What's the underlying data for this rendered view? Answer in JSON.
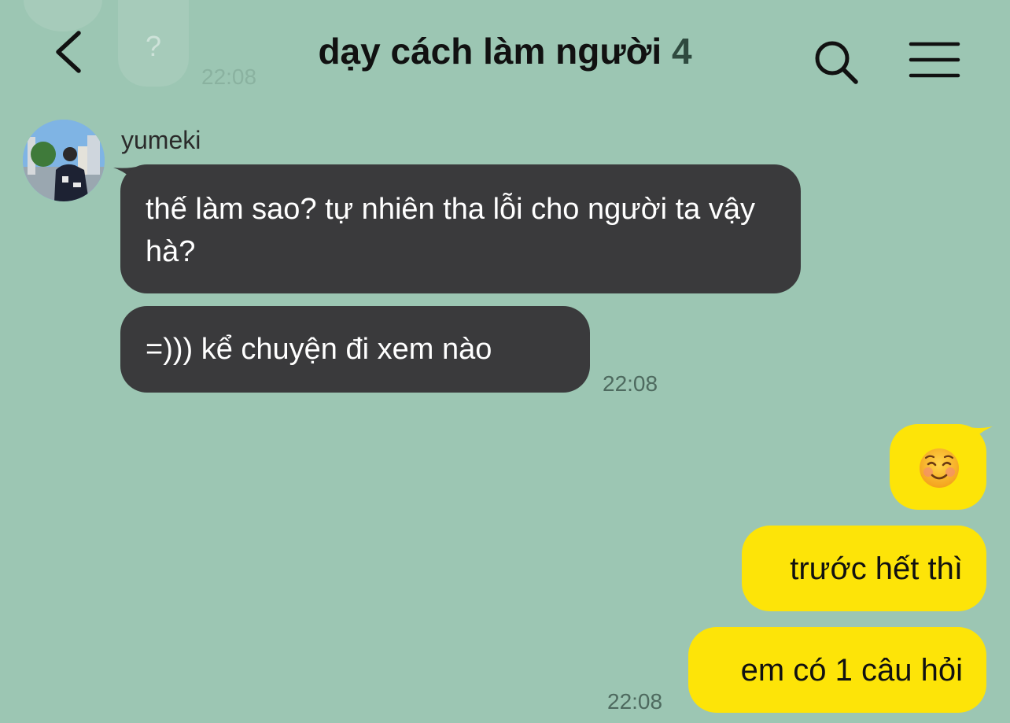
{
  "header": {
    "title": "dạy cách làm người",
    "member_count": "4",
    "faded_prev_text": "?",
    "faded_prev_time": "22:08"
  },
  "messages_in": {
    "sender": "yumeki",
    "bubble_1": "thế làm sao? tự nhiên tha lỗi cho người ta vậy hà?",
    "bubble_2": "=))) kể chuyện đi xem nào",
    "time": "22:08"
  },
  "messages_out": {
    "bubble_1_emoji": "smiling-face-icon",
    "bubble_2": "trước hết thì",
    "bubble_3": "em có 1 câu hỏi",
    "time": "22:08"
  },
  "colors": {
    "background": "#9cc6b3",
    "incoming_bubble": "#3a3a3c",
    "outgoing_bubble": "#fde408",
    "timestamp": "#4e6a5f"
  }
}
